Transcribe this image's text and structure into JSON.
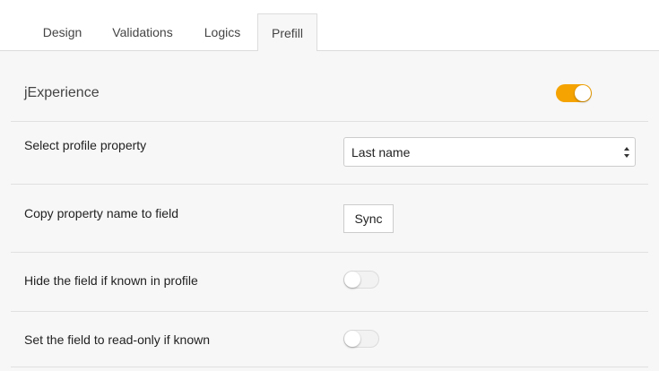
{
  "tabs": [
    {
      "label": "Design",
      "active": false
    },
    {
      "label": "Validations",
      "active": false
    },
    {
      "label": "Logics",
      "active": false
    },
    {
      "label": "Prefill",
      "active": true
    }
  ],
  "section": {
    "title": "jExperience",
    "enabled": true,
    "accent_color": "#f4a300"
  },
  "rows": {
    "profile_property": {
      "label": "Select profile property",
      "selected": "Last name"
    },
    "copy_property": {
      "label": "Copy property name to field",
      "button_label": "Sync"
    },
    "hide_if_known": {
      "label": "Hide the field if known in profile",
      "enabled": false
    },
    "read_only_if_known": {
      "label": "Set the field to read-only if known",
      "enabled": false
    }
  }
}
